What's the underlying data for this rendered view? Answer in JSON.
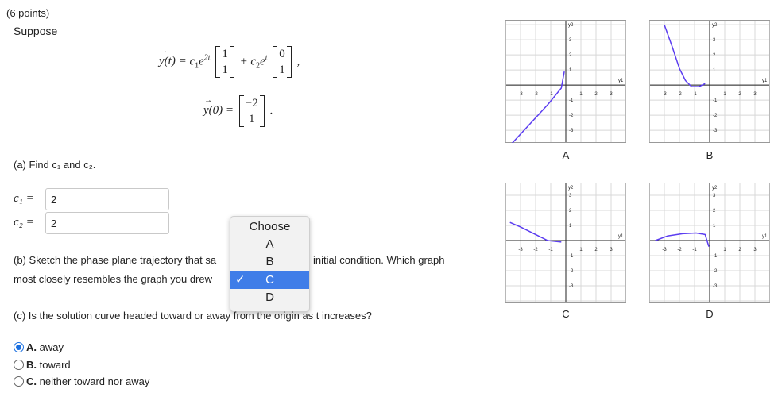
{
  "header": {
    "points": "(6 points)",
    "intro": "Suppose"
  },
  "equation": {
    "lhs": "y(t) = ",
    "c1": "c",
    "c1_sub": "1",
    "e1": "e",
    "e1_exp": "2t",
    "vec1": [
      "1",
      "1"
    ],
    "plus": " + c",
    "c2_sub": "2",
    "e2": "e",
    "e2_exp": "t",
    "vec2": [
      "0",
      "1"
    ],
    "comma": ",",
    "ic_lhs": "y(0) = ",
    "ic_vec": [
      "−2",
      "1"
    ],
    "period": "."
  },
  "part_a": {
    "prompt": "(a) Find c₁ and c₂.",
    "c1_label": "c₁ =",
    "c1_value": "2",
    "c2_label": "c₂ =",
    "c2_value": "2"
  },
  "part_b": {
    "prompt_left": "(b) Sketch the phase plane trajectory that sa",
    "prompt_right": "initial condition. Which graph",
    "prompt_line2": "most closely resembles the graph you drew",
    "dropdown": {
      "placeholder": "Choose",
      "options": [
        "A",
        "B",
        "C",
        "D"
      ],
      "selected": "C",
      "check": "✓"
    }
  },
  "part_c": {
    "prompt": "(c) Is the solution curve headed toward or away from the origin as t increases?",
    "options": [
      {
        "letter": "A.",
        "text": "away",
        "selected": true
      },
      {
        "letter": "B.",
        "text": "toward",
        "selected": false
      },
      {
        "letter": "C.",
        "text": "neither toward nor away",
        "selected": false
      }
    ]
  },
  "graphs": {
    "axis_x": "y1",
    "axis_y": "y2",
    "ticks": [
      "-3",
      "-2",
      "-1",
      "1",
      "2",
      "3"
    ],
    "labels": [
      "A",
      "B",
      "C",
      "D"
    ],
    "curve_color": "#5b3df0"
  }
}
